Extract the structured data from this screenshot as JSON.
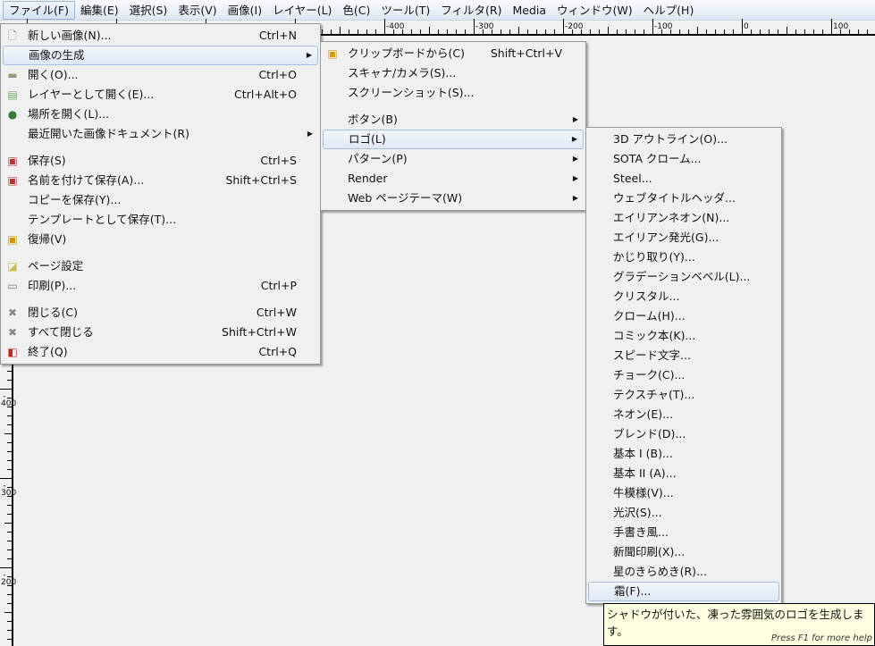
{
  "menubar": [
    "ファイル(F)",
    "編集(E)",
    "選択(S)",
    "表示(V)",
    "画像(I)",
    "レイヤー(L)",
    "色(C)",
    "ツール(T)",
    "フィルタ(R)",
    "Media",
    "ウィンドウ(W)",
    "ヘルプ(H)"
  ],
  "rulers": {
    "horizontal": [
      "-400",
      "-300",
      "-200",
      "-100",
      "0",
      "100"
    ],
    "vertical": [
      "400",
      "300",
      "200"
    ]
  },
  "file_menu": [
    {
      "label": "新しい画像(N)...",
      "shortcut": "Ctrl+N",
      "icon": "new-document-icon"
    },
    {
      "label": "画像の生成",
      "submenu": true,
      "highlighted": true
    },
    {
      "label": "開く(O)...",
      "shortcut": "Ctrl+O",
      "icon": "open-folder-icon"
    },
    {
      "label": "レイヤーとして開く(E)...",
      "shortcut": "Ctrl+Alt+O",
      "icon": "open-as-layer-icon"
    },
    {
      "label": "場所を開く(L)...",
      "icon": "globe-icon"
    },
    {
      "label": "最近開いた画像ドキュメント(R)",
      "submenu": true
    },
    {
      "separator": true
    },
    {
      "label": "保存(S)",
      "shortcut": "Ctrl+S",
      "icon": "save-icon"
    },
    {
      "label": "名前を付けて保存(A)...",
      "shortcut": "Shift+Ctrl+S",
      "icon": "save-as-icon"
    },
    {
      "label": "コピーを保存(Y)..."
    },
    {
      "label": "テンプレートとして保存(T)..."
    },
    {
      "label": "復帰(V)",
      "icon": "revert-icon"
    },
    {
      "separator": true
    },
    {
      "label": "ページ設定",
      "icon": "page-setup-icon"
    },
    {
      "label": "印刷(P)...",
      "shortcut": "Ctrl+P",
      "icon": "print-icon"
    },
    {
      "separator": true
    },
    {
      "label": "閉じる(C)",
      "shortcut": "Ctrl+W",
      "icon": "close-icon"
    },
    {
      "label": "すべて閉じる",
      "shortcut": "Shift+Ctrl+W",
      "icon": "close-all-icon"
    },
    {
      "label": "終了(Q)",
      "shortcut": "Ctrl+Q",
      "icon": "quit-icon"
    }
  ],
  "create_menu": [
    {
      "label": "クリップボードから(C)",
      "shortcut": "Shift+Ctrl+V",
      "icon": "clipboard-icon"
    },
    {
      "label": "スキャナ/カメラ(S)..."
    },
    {
      "label": "スクリーンショット(S)..."
    },
    {
      "separator": true
    },
    {
      "label": "ボタン(B)",
      "submenu": true
    },
    {
      "label": "ロゴ(L)",
      "submenu": true,
      "highlighted": true
    },
    {
      "label": "パターン(P)",
      "submenu": true
    },
    {
      "label": "Render",
      "submenu": true
    },
    {
      "label": "Web ページテーマ(W)",
      "submenu": true
    }
  ],
  "logo_menu": [
    {
      "label": "3D アウトライン(O)..."
    },
    {
      "label": "SOTA クローム..."
    },
    {
      "label": "Steel..."
    },
    {
      "label": "ウェブタイトルヘッダ..."
    },
    {
      "label": "エイリアンネオン(N)..."
    },
    {
      "label": "エイリアン発光(G)..."
    },
    {
      "label": "かじり取り(Y)..."
    },
    {
      "label": "グラデーションベベル(L)..."
    },
    {
      "label": "クリスタル..."
    },
    {
      "label": "クローム(H)..."
    },
    {
      "label": "コミック本(K)..."
    },
    {
      "label": "スピード文字..."
    },
    {
      "label": "チョーク(C)..."
    },
    {
      "label": "テクスチャ(T)..."
    },
    {
      "label": "ネオン(E)..."
    },
    {
      "label": "ブレンド(D)..."
    },
    {
      "label": "基本 I (B)..."
    },
    {
      "label": "基本 II (A)..."
    },
    {
      "label": "牛模様(V)..."
    },
    {
      "label": "光沢(S)..."
    },
    {
      "label": "手書き風..."
    },
    {
      "label": "新聞印刷(X)..."
    },
    {
      "label": "星のきらめき(R)..."
    },
    {
      "label": "霜(F)...",
      "highlighted": true
    }
  ],
  "tooltip": {
    "text": "シャドウが付いた、凍った雰囲気のロゴを生成します。",
    "help": "Press F1 for more help"
  },
  "arrow_glyph": "▶"
}
